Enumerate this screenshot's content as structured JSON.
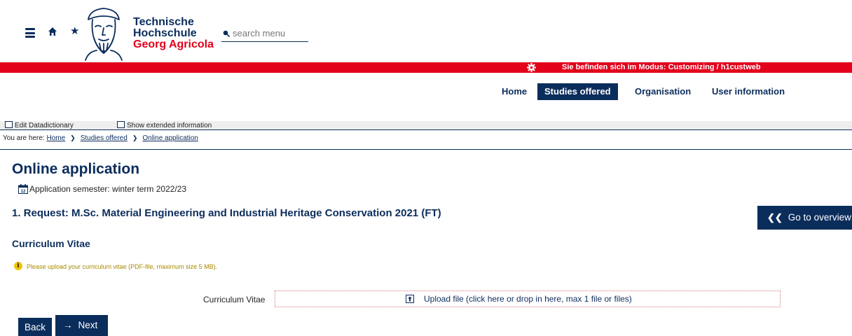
{
  "header": {
    "logo_lines": [
      "Technische",
      "Hochschule",
      "Georg Agricola"
    ],
    "search_placeholder": "search menu",
    "icons": [
      "hamburger-menu-icon",
      "home-icon",
      "star-icon",
      "search-icon"
    ]
  },
  "system_bar": {
    "mode_text": "Sie befinden sich im Modus: Customizing / h1custweb",
    "icon": "gear-icon",
    "color": "#e2001a"
  },
  "nav": {
    "items": [
      {
        "label": "Home",
        "active": false
      },
      {
        "label": "Studies offered",
        "active": true
      },
      {
        "label": "Organisation",
        "active": false
      },
      {
        "label": "User information",
        "active": false
      }
    ]
  },
  "options": {
    "edit_datadictionary": "Edit Datadictionary",
    "show_extended": "Show extended information"
  },
  "breadcrumb": {
    "prefix": "You are here:",
    "items": [
      "Home",
      "Studies offered",
      "Online application"
    ]
  },
  "main": {
    "page_title": "Online application",
    "semester_text": "Application semester: winter term 2022/23",
    "request_title": "1. Request: M.Sc. Material Engineering and Industrial Heritage Conservation 2021 (FT)",
    "overview_button": "Go to overview",
    "section_title": "Curriculum Vitae",
    "info_text": "Please upload your curriculum vitae (PDF-file, maximum size 5 MB).",
    "field_label": "Curriculum Vitae",
    "upload_text": "Upload file (click here or drop in here, max 1 file or files)",
    "back_button": "Back",
    "next_button": "Next"
  },
  "colors": {
    "primary": "#0b2d5c",
    "accent": "#e2001a",
    "info": "#f0c400"
  }
}
